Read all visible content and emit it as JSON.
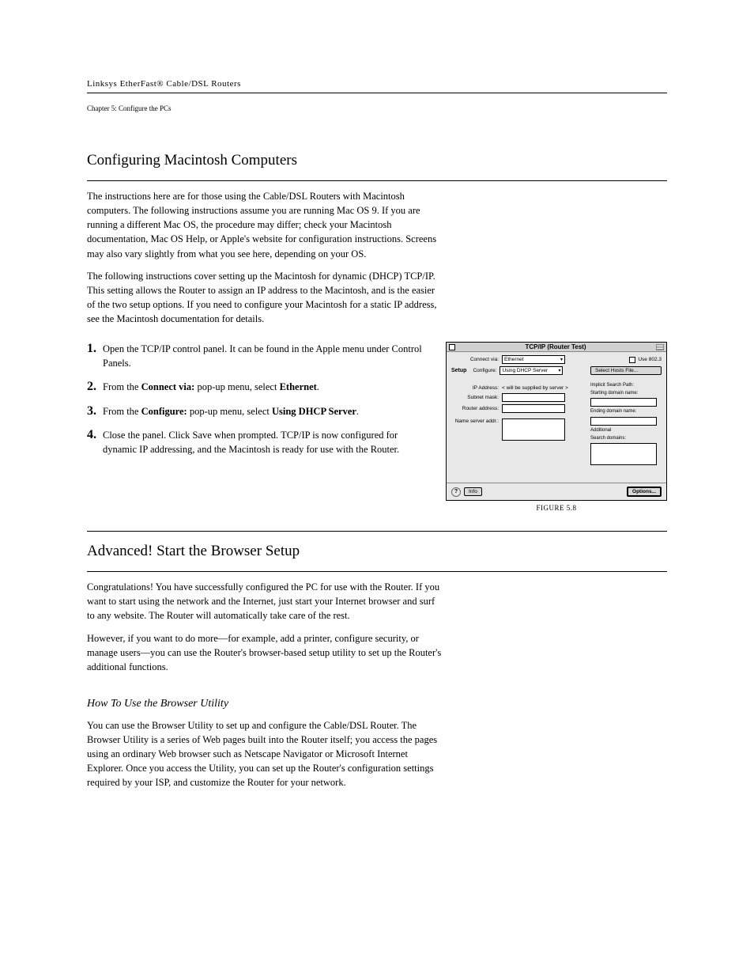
{
  "header": {
    "book_title": "Linksys EtherFast® Cable/DSL Routers",
    "chapter": "Chapter 5: Configure the PCs"
  },
  "sections": {
    "mac_title": "Configuring Macintosh Computers",
    "intro_p1": "The instructions here are for those using the Cable/DSL Routers with Macintosh computers. The following instructions assume you are running Mac OS 9. If you are running a different Mac OS, the procedure may differ; check your Macintosh documentation, Mac OS Help, or Apple's website for configuration instructions. Screens may also vary slightly from what you see here, depending on your OS.",
    "intro_p2": "The following instructions cover setting up the Macintosh for dynamic (DHCP) TCP/IP. This setting allows the Router to assign an IP address to the Macintosh, and is the easier of the two setup options. If you need to configure your Macintosh for a static IP address, see the Macintosh documentation for details.",
    "step1": "Open the TCP/IP control panel. It can be found in the Apple menu under Control Panels.",
    "step2_a": "From the ",
    "step2_b": "Connect via:",
    "step2_c": " pop-up menu, select ",
    "step2_d": "Ethernet",
    "step2_e": ".",
    "step3_a": "From the ",
    "step3_b": "Configure:",
    "step3_c": " pop-up menu, select ",
    "step3_d": "Using DHCP Server",
    "step3_e": ".",
    "step4": "Close the panel. Click Save when prompted. TCP/IP is now configured for dynamic IP addressing, and the Macintosh is ready for use with the Router.",
    "figure_caption": "FIGURE 5.8",
    "advanced_title": "Advanced!  Start the Browser Setup",
    "advanced_p1": "Congratulations! You have successfully configured the PC for use with the Router. If you want to start using the network and the Internet, just start your Internet browser and surf to any website. The Router will automatically take care of the rest.",
    "advanced_p2": "However, if you want to do more—for example, add a printer, configure security, or manage users—you can use the Router's browser-based setup utility to set up the Router's additional functions.",
    "browser_title": "How To Use the Browser Utility",
    "browser_p1": "You can use the Browser Utility to set up and configure the Cable/DSL Router. The Browser Utility is a series of Web pages built into the Router itself; you access the pages using an ordinary Web browser such as Netscape Navigator or Microsoft Internet Explorer. Once you access the Utility, you can set up the Router's configuration settings required by your ISP, and customize the Router for your network."
  },
  "tcpip": {
    "title": "TCP/IP (Router Test)",
    "connect_via_label": "Connect via:",
    "connect_via_value": "Ethernet",
    "use8023_label": "Use 802.3",
    "setup_label": "Setup",
    "configure_label": "Configure:",
    "configure_value": "Using DHCP Server",
    "hosts_button": "Select Hosts File...",
    "ip_label": "IP Address:",
    "ip_value": "< will be supplied by server >",
    "subnet_label": "Subnet mask:",
    "router_label": "Router address:",
    "ns_label": "Name server addr.:",
    "implicit_label": "Implicit Search Path:",
    "starting_label": "Starting domain name:",
    "ending_label": "Ending domain name:",
    "additional_label": "Additional",
    "search_domains_label": "Search domains:",
    "info_button": "Info",
    "options_button": "Options...",
    "q": "?"
  }
}
